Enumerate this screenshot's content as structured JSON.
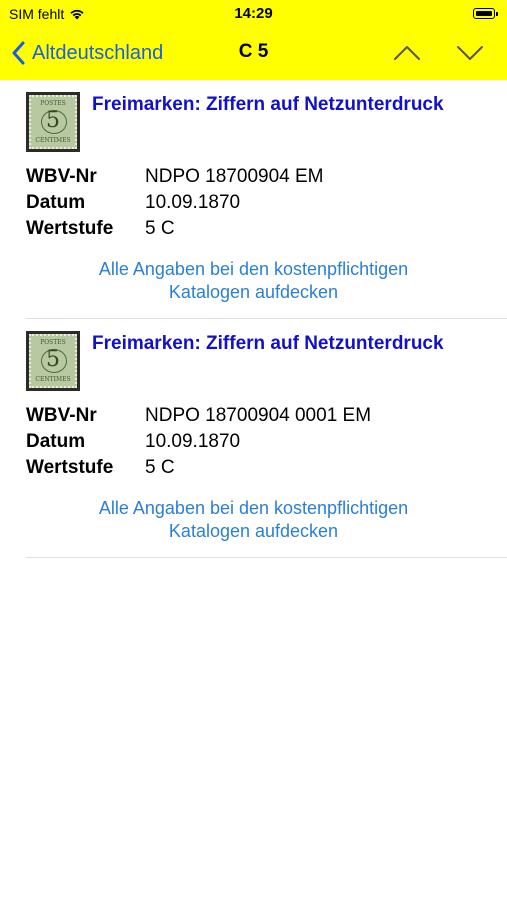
{
  "status_bar": {
    "carrier": "SIM fehlt",
    "time": "14:29",
    "wifi_icon": "wifi-icon",
    "battery_icon": "battery-icon"
  },
  "nav": {
    "back_label": "Altdeutschland",
    "title": "C 5",
    "back_icon": "chevron-left-icon",
    "up_icon": "chevron-up-icon",
    "down_icon": "chevron-down-icon"
  },
  "colors": {
    "bar_background": "#ffff00",
    "title_link": "#1111cc",
    "info_link": "#2a7fd6",
    "nav_tint": "#1a5fe0"
  },
  "entries": [
    {
      "title": "Freimarken: Ziffern auf Netzunterdruck",
      "stamp": {
        "top": "POSTES",
        "digit": "5",
        "bottom": "CENTIMES"
      },
      "wbv_label": "WBV-Nr",
      "wbv_value": "NDPO 18700904 EM",
      "datum_label": "Datum",
      "datum_value": "10.09.1870",
      "wertstufe_label": "Wertstufe",
      "wertstufe_value": "5 C",
      "link_line1": "Alle Angaben bei den kostenpflichtigen",
      "link_line2": "Katalogen aufdecken"
    },
    {
      "title": "Freimarken: Ziffern auf Netzunterdruck",
      "stamp": {
        "top": "POSTES",
        "digit": "5",
        "bottom": "CENTIMES"
      },
      "wbv_label": "WBV-Nr",
      "wbv_value": "NDPO 18700904 0001 EM",
      "datum_label": "Datum",
      "datum_value": "10.09.1870",
      "wertstufe_label": "Wertstufe",
      "wertstufe_value": "5 C",
      "link_line1": "Alle Angaben bei den kostenpflichtigen",
      "link_line2": "Katalogen aufdecken"
    }
  ]
}
